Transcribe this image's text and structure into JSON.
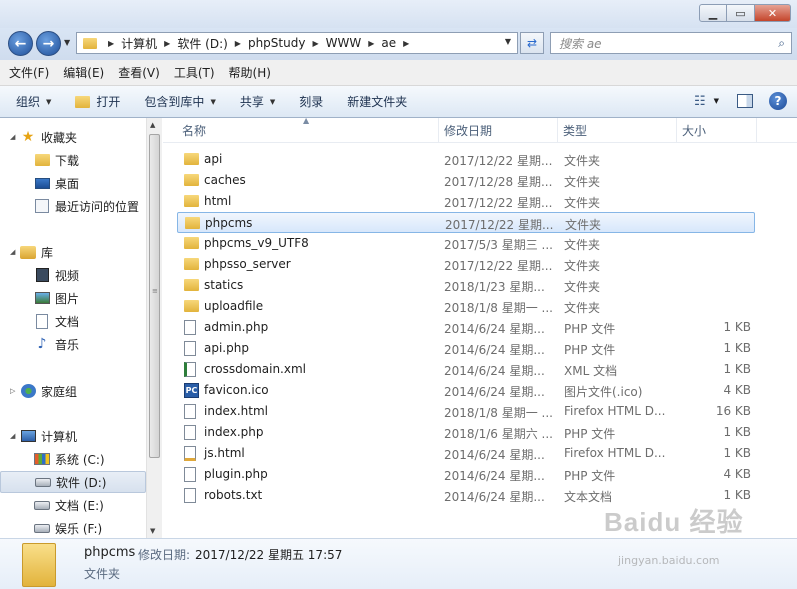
{
  "address": {
    "crumbs": [
      "计算机",
      "软件 (D:)",
      "phpStudy",
      "WWW",
      "ae"
    ]
  },
  "search": {
    "placeholder": "搜索 ae"
  },
  "menu": [
    "文件(F)",
    "编辑(E)",
    "查看(V)",
    "工具(T)",
    "帮助(H)"
  ],
  "toolbar": {
    "organize": "组织",
    "open": "打开",
    "include_library": "包含到库中",
    "share": "共享",
    "burn": "刻录",
    "new_folder": "新建文件夹"
  },
  "nav": {
    "favorites": "收藏夹",
    "downloads": "下载",
    "desktop": "桌面",
    "recent": "最近访问的位置",
    "libraries": "库",
    "videos": "视频",
    "pictures": "图片",
    "documents": "文档",
    "music": "音乐",
    "homegroup": "家庭组",
    "computer": "计算机",
    "drive_c": "系统 (C:)",
    "drive_d": "软件 (D:)",
    "drive_e": "文档 (E:)",
    "drive_f": "娱乐 (F:)"
  },
  "columns": {
    "name": "名称",
    "date": "修改日期",
    "type": "类型",
    "size": "大小"
  },
  "files": [
    {
      "name": "api",
      "date": "2017/12/22 星期...",
      "type": "文件夹",
      "size": "",
      "icon": "folder"
    },
    {
      "name": "caches",
      "date": "2017/12/28 星期...",
      "type": "文件夹",
      "size": "",
      "icon": "folder"
    },
    {
      "name": "html",
      "date": "2017/12/22 星期...",
      "type": "文件夹",
      "size": "",
      "icon": "folder"
    },
    {
      "name": "phpcms",
      "date": "2017/12/22 星期...",
      "type": "文件夹",
      "size": "",
      "icon": "folder"
    },
    {
      "name": "phpcms_v9_UTF8",
      "date": "2017/5/3 星期三 ...",
      "type": "文件夹",
      "size": "",
      "icon": "folder"
    },
    {
      "name": "phpsso_server",
      "date": "2017/12/22 星期...",
      "type": "文件夹",
      "size": "",
      "icon": "folder"
    },
    {
      "name": "statics",
      "date": "2018/1/23 星期...",
      "type": "文件夹",
      "size": "",
      "icon": "folder"
    },
    {
      "name": "uploadfile",
      "date": "2018/1/8 星期一 ...",
      "type": "文件夹",
      "size": "",
      "icon": "folder"
    },
    {
      "name": "admin.php",
      "date": "2014/6/24 星期...",
      "type": "PHP 文件",
      "size": "1 KB",
      "icon": "file"
    },
    {
      "name": "api.php",
      "date": "2014/6/24 星期...",
      "type": "PHP 文件",
      "size": "1 KB",
      "icon": "file"
    },
    {
      "name": "crossdomain.xml",
      "date": "2014/6/24 星期...",
      "type": "XML 文档",
      "size": "1 KB",
      "icon": "xml"
    },
    {
      "name": "favicon.ico",
      "date": "2014/6/24 星期...",
      "type": "图片文件(.ico)",
      "size": "4 KB",
      "icon": "ico"
    },
    {
      "name": "index.html",
      "date": "2018/1/8 星期一 ...",
      "type": "Firefox HTML D...",
      "size": "16 KB",
      "icon": "file"
    },
    {
      "name": "index.php",
      "date": "2018/1/6 星期六 ...",
      "type": "PHP 文件",
      "size": "1 KB",
      "icon": "file"
    },
    {
      "name": "js.html",
      "date": "2014/6/24 星期...",
      "type": "Firefox HTML D...",
      "size": "1 KB",
      "icon": "js"
    },
    {
      "name": "plugin.php",
      "date": "2014/6/24 星期...",
      "type": "PHP 文件",
      "size": "4 KB",
      "icon": "file"
    },
    {
      "name": "robots.txt",
      "date": "2014/6/24 星期...",
      "type": "文本文档",
      "size": "1 KB",
      "icon": "file"
    }
  ],
  "selected_index": 3,
  "details": {
    "name": "phpcms",
    "meta_label": "修改日期:",
    "meta_value": "2017/12/22 星期五 17:57",
    "type": "文件夹"
  },
  "watermark": {
    "brand": "Baidu 经验",
    "url": "jingyan.baidu.com"
  }
}
